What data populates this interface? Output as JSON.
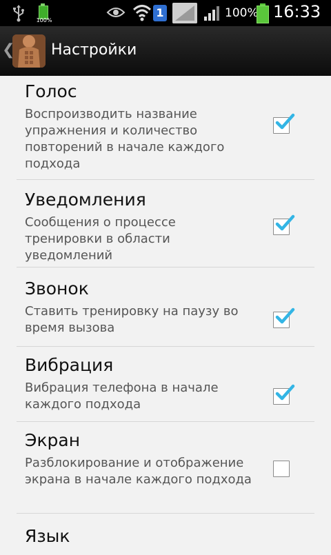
{
  "status_bar": {
    "battery_small_pct": "100%",
    "sim_slot": "1",
    "battery_pct": "100%",
    "time": "16:33",
    "colors": {
      "battery": "#5ac73b",
      "sim": "#2f6fd1"
    },
    "icons": [
      "usb-icon",
      "battery-small-icon",
      "eye-icon",
      "wifi-icon",
      "sim-icon",
      "no-signal-icon",
      "signal-icon",
      "battery-icon"
    ]
  },
  "action_bar": {
    "title": "Настройки",
    "icons": [
      "back-icon",
      "app-logo"
    ]
  },
  "preferences": [
    {
      "title": "Голос",
      "summary": "Воспроизводить название упражнения и количество повторений в начале каждого подхода",
      "checked": true
    },
    {
      "title": "Уведомления",
      "summary": "Сообщения о процессе тренировки в области уведомлений",
      "checked": true
    },
    {
      "title": "Звонок",
      "summary": "Ставить тренировку на паузу во время вызова",
      "checked": true
    },
    {
      "title": "Вибрация",
      "summary": "Вибрация телефона в начале каждого подхода",
      "checked": true
    },
    {
      "title": "Экран",
      "summary": "Разблокирование и отображение экрана в начале каждого подхода",
      "checked": false
    },
    {
      "title": "Язык",
      "summary": "",
      "checked": null
    }
  ],
  "accent_color": "#33b5e5"
}
